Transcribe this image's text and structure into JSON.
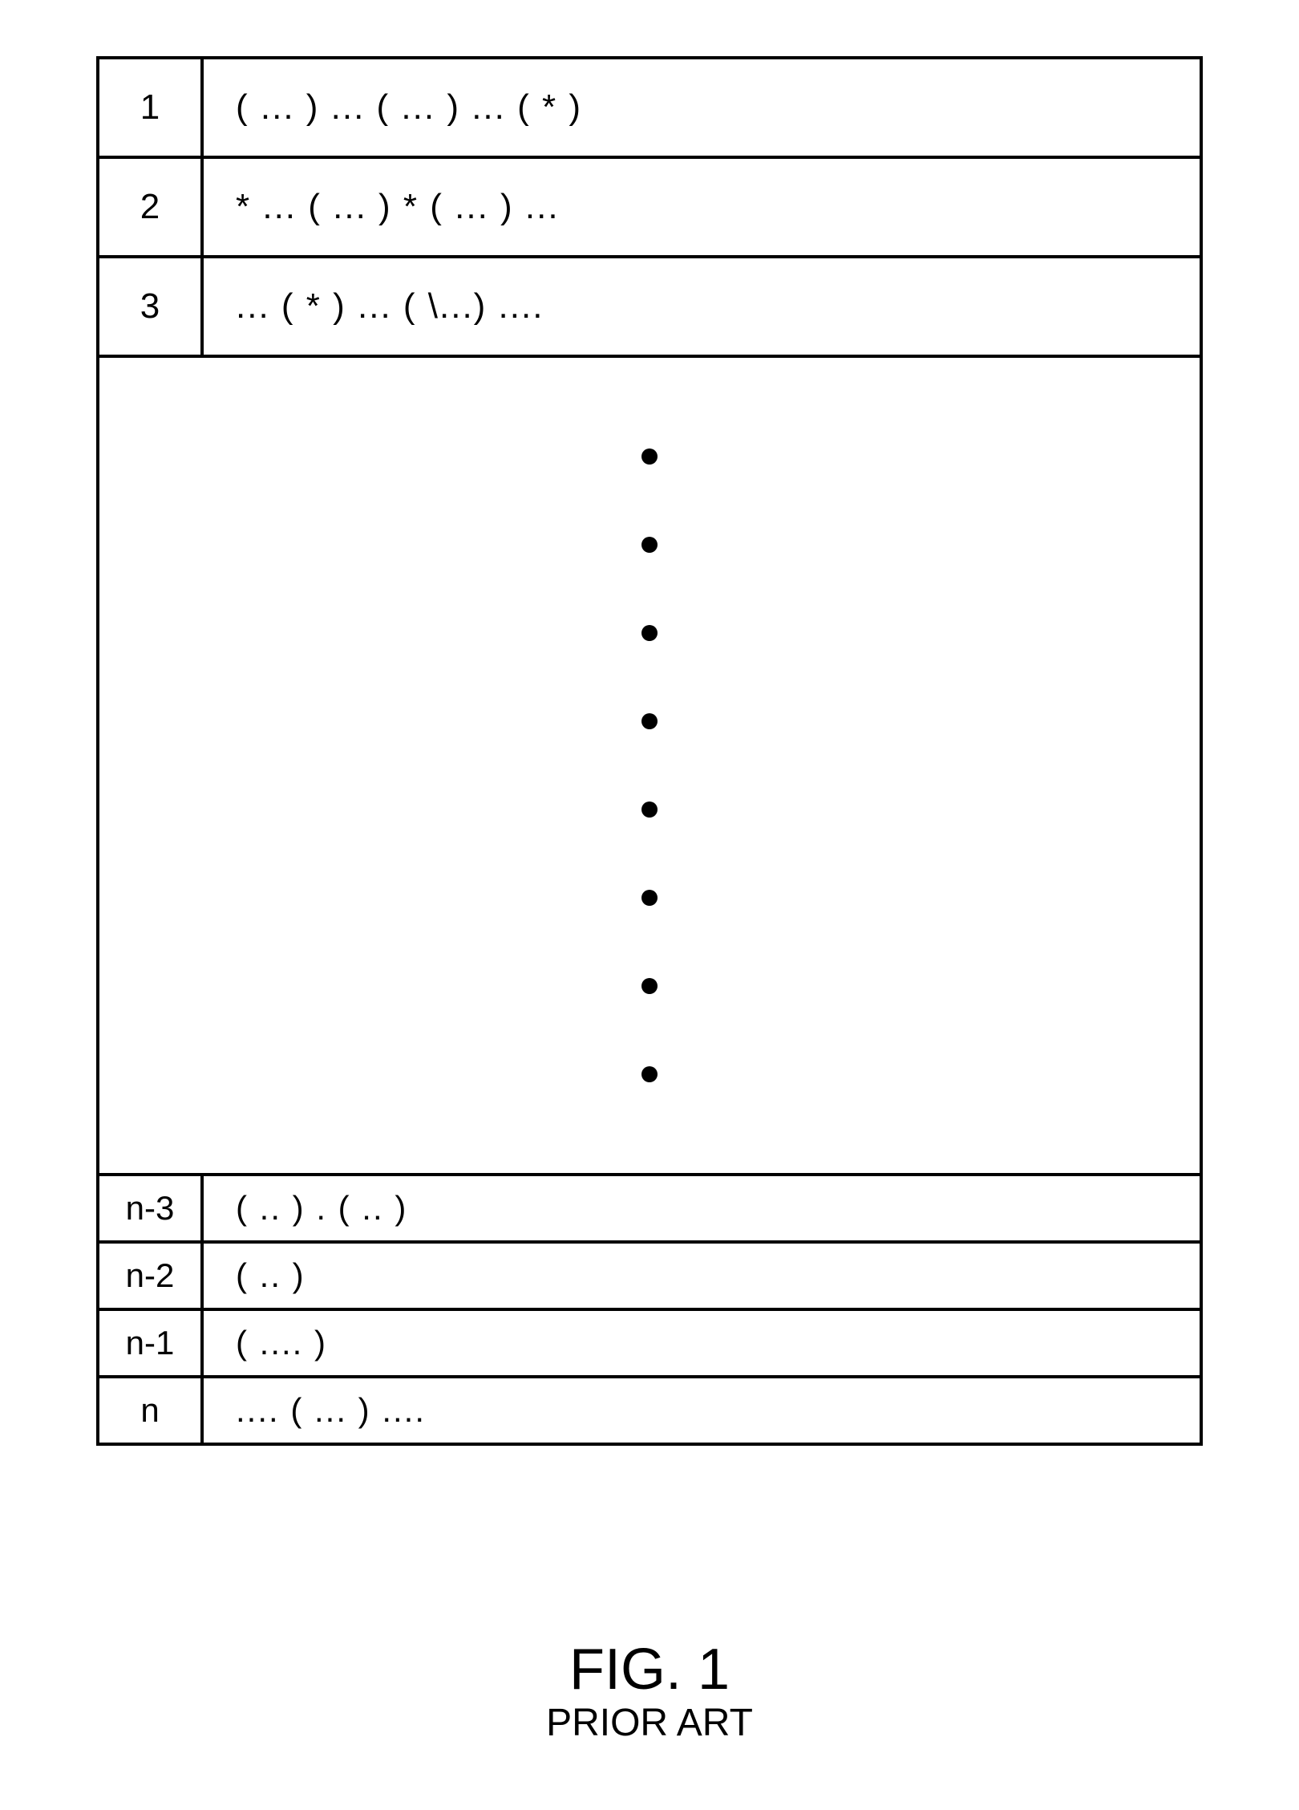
{
  "figure": {
    "label": "FIG. 1",
    "subtitle": "PRIOR ART"
  },
  "rows_top": [
    {
      "index": "1",
      "pattern": "( ... ) ... ( ... ) ... ( * )"
    },
    {
      "index": "2",
      "pattern": "* ... ( ... ) * ( ... ) ..."
    },
    {
      "index": "3",
      "pattern": "... ( * ) ... ( \\...) ...."
    }
  ],
  "ellipsis_dot_count": 8,
  "rows_bottom": [
    {
      "index": "n-3",
      "pattern": "( .. ) . ( .. )"
    },
    {
      "index": "n-2",
      "pattern": "( .. )"
    },
    {
      "index": "n-1",
      "pattern": "( .... )"
    },
    {
      "index": "n",
      "pattern": ".... ( ... ) ...."
    }
  ]
}
